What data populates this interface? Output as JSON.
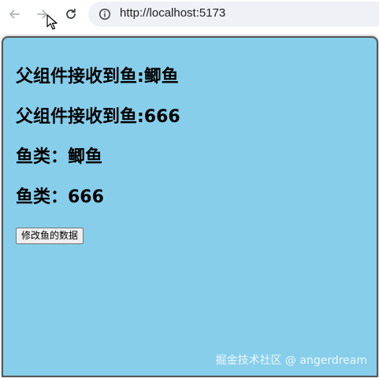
{
  "browser": {
    "url": "http://localhost:5173",
    "back_icon": "arrow-left-icon",
    "forward_icon": "arrow-right-icon",
    "reload_icon": "reload-icon",
    "site_info_icon": "info-circle-icon"
  },
  "page": {
    "background_color": "#87ceeb",
    "headings": [
      "父组件接收到鱼:鲫鱼",
      "父组件接收到鱼:666",
      "鱼类：鲫鱼",
      "鱼类：666"
    ],
    "modify_button_label": "修改鱼的数据"
  },
  "watermark": "掘金技术社区 @ angerdream"
}
